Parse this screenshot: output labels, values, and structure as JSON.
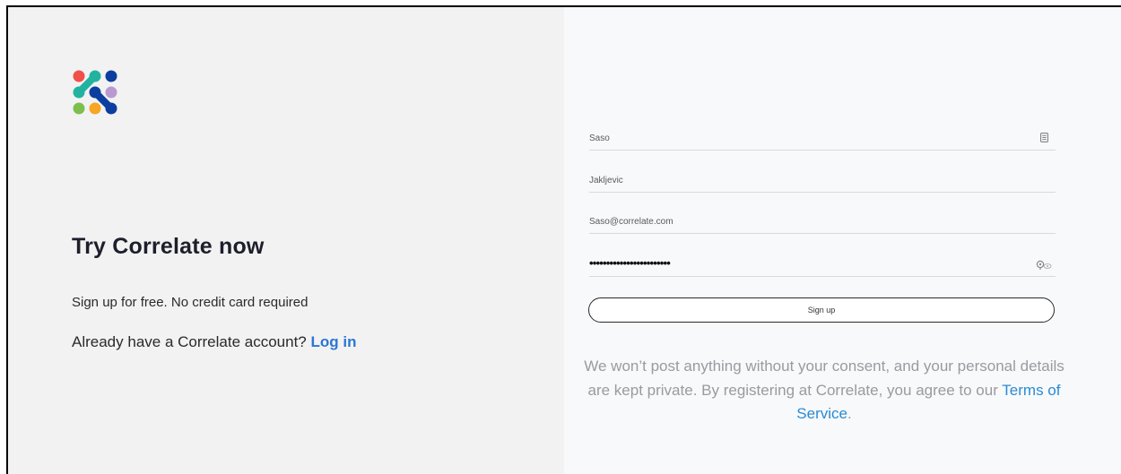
{
  "left_panel": {
    "headline": "Try Correlate now",
    "subline": "Sign up for free. No credit card required",
    "login_prompt": "Already have a Correlate account?",
    "login_link": "Log in"
  },
  "form": {
    "first_name": {
      "value": "Saso",
      "icon": "contact-card-icon"
    },
    "last_name": {
      "value": "Jakljevic"
    },
    "email": {
      "value": "Saso@correlate.com"
    },
    "password": {
      "value": "••••••••••••••••••••••••",
      "icon": "show-password-icon"
    },
    "signup_label": "Sign up"
  },
  "disclaimer": {
    "text": "We won’t post anything without your consent, and your personal details are kept private. By registering at Correlate, you agree to our",
    "tos_link": "Terms of Service",
    "end": "."
  },
  "colors": {
    "link": "#2a77d4",
    "tos_link": "#2a8bd4",
    "left_background": "#f2f2f2",
    "right_background": "#f8f9fb",
    "logo_dots": [
      "#f0504a",
      "#22b3a0",
      "#0b3e9f",
      "#22b3a0",
      "#0b3e9f",
      "#b99ad0",
      "#7cbf4f",
      "#f5a623",
      "#0b3e9f"
    ]
  }
}
